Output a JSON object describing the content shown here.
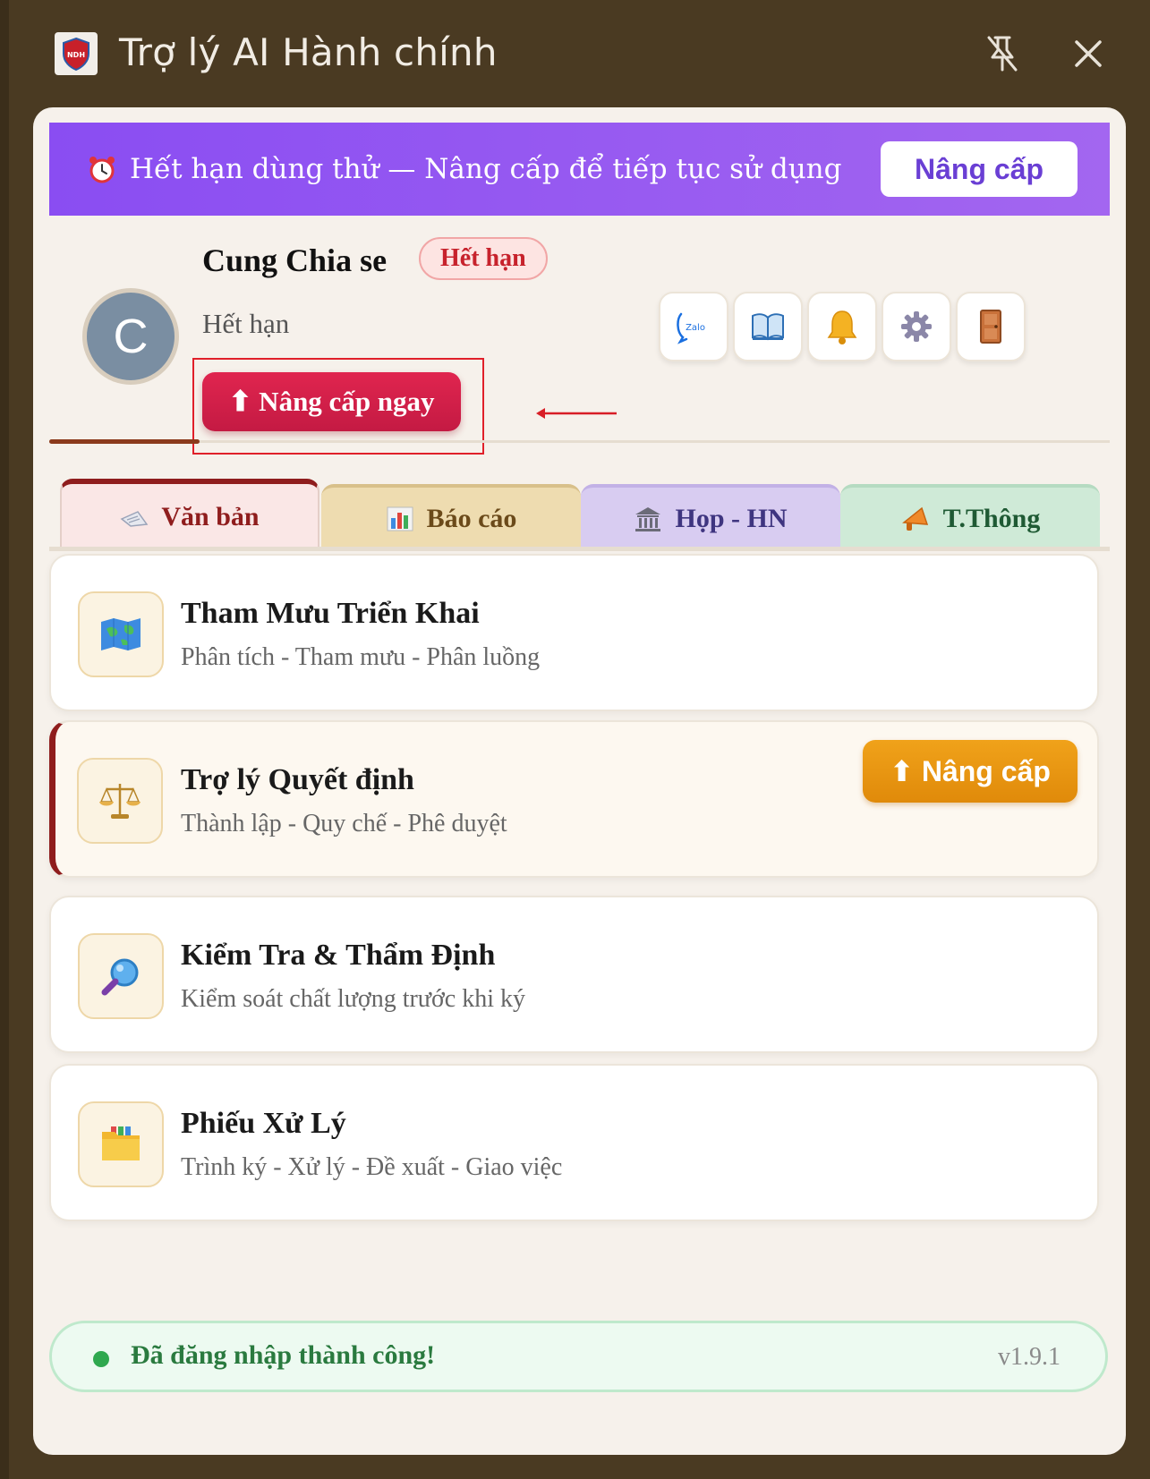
{
  "window": {
    "title": "Trợ lý AI Hành chính",
    "logo_text": "NDH"
  },
  "banner": {
    "text": "Hết hạn dùng thử — Nâng cấp để tiếp tục sử dụng",
    "button": "Nâng cấp"
  },
  "profile": {
    "avatar_letter": "C",
    "name": "Cung Chia se",
    "badge": "Hết hạn",
    "status": "Hết hạn",
    "upgrade_button": "⬆ Nâng cấp ngay"
  },
  "toolbar_icons": [
    {
      "name": "zalo-icon",
      "label": "Zalo"
    },
    {
      "name": "book-icon"
    },
    {
      "name": "bell-icon"
    },
    {
      "name": "gear-icon"
    },
    {
      "name": "door-icon"
    }
  ],
  "tabs": [
    {
      "label": "Văn bản",
      "icon": "document-icon",
      "active": true
    },
    {
      "label": "Báo cáo",
      "icon": "bar-chart-icon"
    },
    {
      "label": "Họp - HN",
      "icon": "building-icon"
    },
    {
      "label": "T.Thông",
      "icon": "megaphone-icon"
    }
  ],
  "cards": [
    {
      "title": "Tham Mưu Triển Khai",
      "subtitle": "Phân tích - Tham mưu - Phân luồng",
      "icon": "map-icon"
    },
    {
      "title": "Trợ lý Quyết định",
      "subtitle": "Thành lập - Quy chế - Phê duyệt",
      "icon": "scales-icon",
      "upgrade_label": "⬆ Nâng cấp"
    },
    {
      "title": "Kiểm Tra & Thẩm Định",
      "subtitle": "Kiểm soát chất lượng trước khi ký",
      "icon": "magnifier-icon"
    },
    {
      "title": "Phiếu Xử Lý",
      "subtitle": "Trình ký - Xử lý - Đề xuất - Giao việc",
      "icon": "folder-icon"
    }
  ],
  "status": {
    "message": "Đã đăng nhập thành công!",
    "version": "v1.9.1"
  },
  "colors": {
    "accent": "#8a4df2",
    "danger": "#c41a43",
    "warning": "#e08a0a",
    "success": "#2fa84f"
  }
}
